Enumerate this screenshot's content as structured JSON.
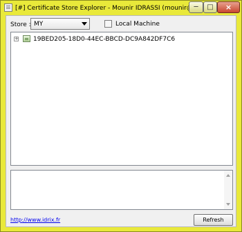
{
  "window": {
    "title": "[#] Certificate Store Explorer  -  Mounir IDRASSI (mounir@idrix.fr) ..."
  },
  "controls": {
    "store_label": "Store :",
    "store_value": "MY",
    "local_machine_label": "Local Machine",
    "local_machine_checked": false
  },
  "tree": {
    "items": [
      {
        "label": "19BED205-18D0-44EC-BBCD-DC9A842DF7C6",
        "expander": "+"
      }
    ]
  },
  "footer": {
    "website": "http://www.idrix.fr",
    "refresh_label": "Refresh"
  },
  "icons": {
    "app": "certificate-explorer-icon",
    "tree_item": "certificate-icon"
  }
}
